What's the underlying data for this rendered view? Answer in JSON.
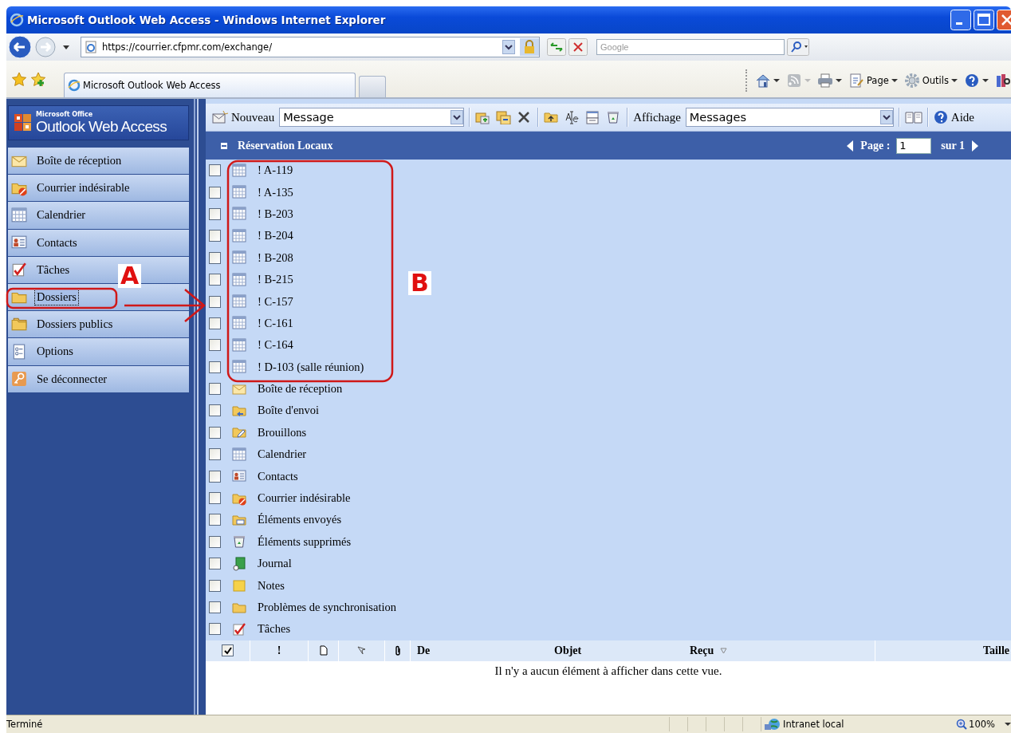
{
  "browser": {
    "title": "Microsoft Outlook Web Access - Windows Internet Explorer",
    "address": "https://courrier.cfpmr.com/exchange/",
    "search": {
      "placeholder": "Google"
    },
    "tabs": [
      {
        "label": "Microsoft Outlook Web Access",
        "selected": true
      }
    ],
    "commands": [
      {
        "kind": "home"
      },
      {
        "kind": "feed"
      },
      {
        "kind": "print"
      },
      {
        "kind": "page",
        "label": "Page"
      },
      {
        "kind": "tools",
        "label": "Outils"
      },
      {
        "kind": "help"
      },
      {
        "kind": "research"
      }
    ]
  },
  "owa": {
    "logo": {
      "brand": "Microsoft Office",
      "product": "Outlook Web Access"
    },
    "nav": [
      {
        "label": "Boîte de réception",
        "kind": "inbox",
        "selected": false
      },
      {
        "label": "Courrier indésirable",
        "kind": "junk",
        "selected": false
      },
      {
        "label": "Calendrier",
        "kind": "calendar",
        "selected": false
      },
      {
        "label": "Contacts",
        "kind": "contacts",
        "selected": false
      },
      {
        "label": "Tâches",
        "kind": "tasks",
        "selected": false
      },
      {
        "label": "Dossiers",
        "kind": "folder",
        "selected": true
      },
      {
        "label": "Dossiers publics",
        "kind": "public",
        "selected": false
      },
      {
        "label": "Options",
        "kind": "options",
        "selected": false
      },
      {
        "label": "Se déconnecter",
        "kind": "logout",
        "selected": false
      }
    ],
    "toolbar": {
      "new_label": "Nouveau",
      "new_type": "Message",
      "view_label": "Affichage",
      "view_type": "Messages",
      "help": "Aide"
    },
    "folder_header": {
      "title": "Réservation Locaux",
      "page_label": "Page :",
      "page": "1",
      "page_total": "sur 1"
    },
    "folders": [
      {
        "name": "! A-119",
        "kind": "calendar",
        "checked": false
      },
      {
        "name": "! A-135",
        "kind": "calendar",
        "checked": false
      },
      {
        "name": "! B-203",
        "kind": "calendar",
        "checked": false
      },
      {
        "name": "! B-204",
        "kind": "calendar",
        "checked": false
      },
      {
        "name": "! B-208",
        "kind": "calendar",
        "checked": false
      },
      {
        "name": "! B-215",
        "kind": "calendar",
        "checked": false
      },
      {
        "name": "! C-157",
        "kind": "calendar",
        "checked": false
      },
      {
        "name": "! C-161",
        "kind": "calendar",
        "checked": false
      },
      {
        "name": "! C-164",
        "kind": "calendar",
        "checked": false
      },
      {
        "name": "! D-103 (salle réunion)",
        "kind": "calendar",
        "checked": false
      },
      {
        "name": "Boîte de réception",
        "kind": "inbox",
        "checked": false
      },
      {
        "name": "Boîte d'envoi",
        "kind": "outbox",
        "checked": false
      },
      {
        "name": "Brouillons",
        "kind": "drafts",
        "checked": false
      },
      {
        "name": "Calendrier",
        "kind": "calendar",
        "checked": false
      },
      {
        "name": "Contacts",
        "kind": "contacts",
        "checked": false
      },
      {
        "name": "Courrier indésirable",
        "kind": "junk",
        "checked": false
      },
      {
        "name": "Éléments envoyés",
        "kind": "sent",
        "checked": false
      },
      {
        "name": "Éléments supprimés",
        "kind": "deleted",
        "checked": false
      },
      {
        "name": "Journal",
        "kind": "journal",
        "checked": false
      },
      {
        "name": "Notes",
        "kind": "notes",
        "checked": false
      },
      {
        "name": "Problèmes de synchronisation",
        "kind": "sync",
        "checked": false
      },
      {
        "name": "Tâches",
        "kind": "tasks",
        "checked": false
      }
    ],
    "columns": [
      {
        "kind": "checkbox",
        "checked": true
      },
      {
        "kind": "text",
        "label": "!",
        "sorted": false
      },
      {
        "kind": "document"
      },
      {
        "kind": "flag"
      },
      {
        "kind": "clip"
      },
      {
        "kind": "text",
        "label": "De",
        "sorted": false
      },
      {
        "kind": "text",
        "label": "Objet",
        "sorted": false
      },
      {
        "kind": "text",
        "label": "Reçu",
        "sorted": true
      },
      {
        "kind": "text",
        "label": "Taille",
        "sorted": false
      }
    ],
    "empty_message": "Il n'y a aucun élément à afficher dans cette vue."
  },
  "annotations": [
    {
      "label": "A"
    },
    {
      "label": "B"
    }
  ],
  "status_bar": {
    "text": "Terminé",
    "zone": "Intranet local",
    "zoom": "100%"
  }
}
